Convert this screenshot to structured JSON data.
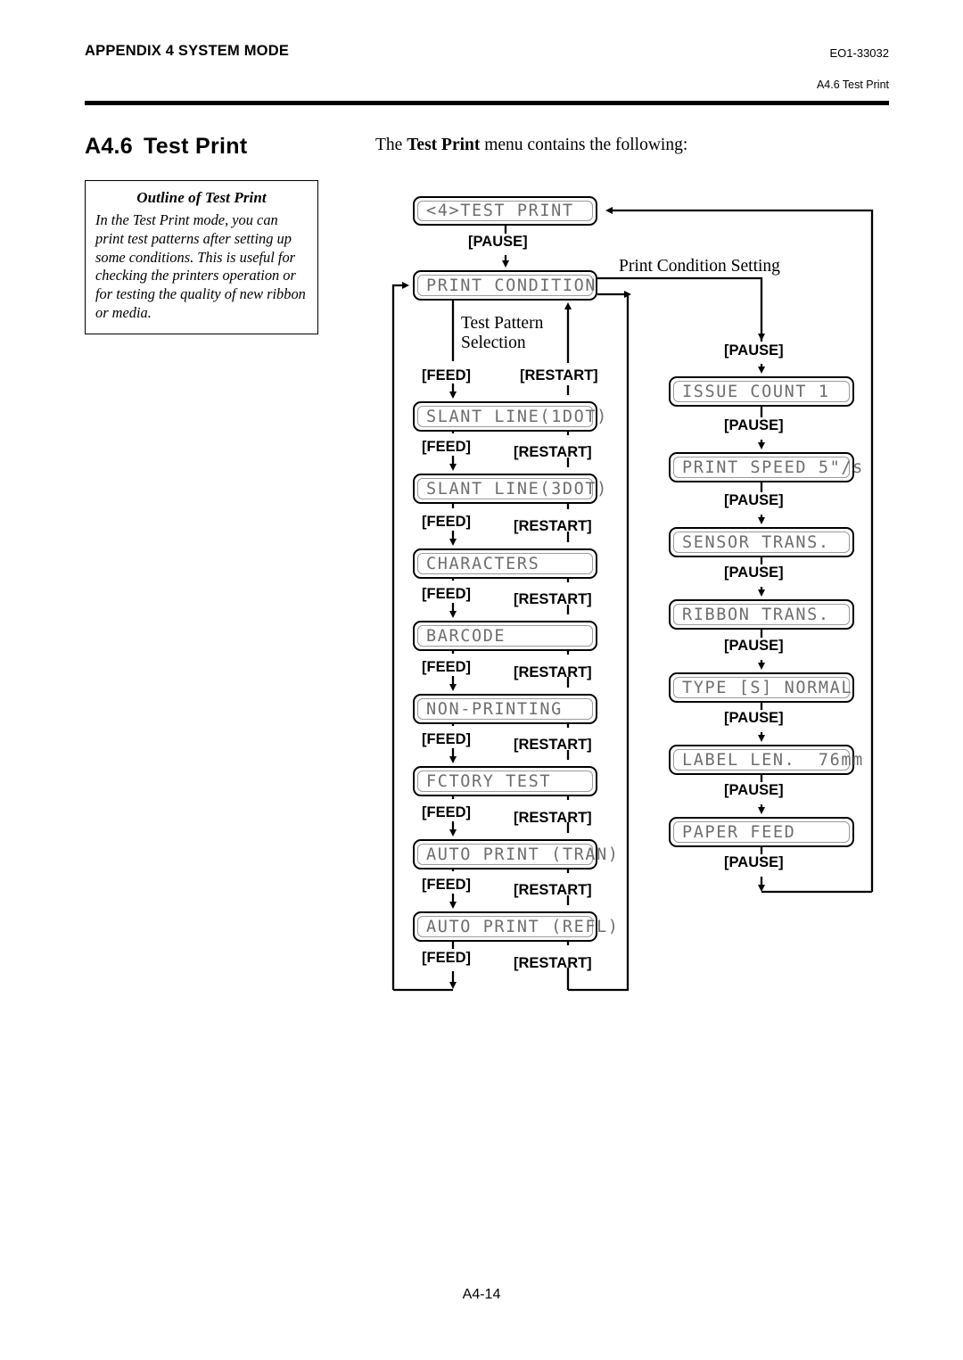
{
  "header": {
    "left_title": "APPENDIX 4 SYSTEM MODE",
    "doc_code": "EO1-33032",
    "section_ref": "A4.6 Test Print"
  },
  "section": {
    "number": "A4.6",
    "title": "Test Print"
  },
  "outline_box": {
    "title": "Outline of Test Print",
    "body": "In the Test Print mode, you can print test patterns after setting up some conditions. This is useful for checking the printers operation or for testing the quality of new ribbon or media."
  },
  "intro": {
    "before": "The ",
    "bold": "Test Print",
    "after": " menu contains the following:"
  },
  "annotations": {
    "print_condition_setting": "Print Condition Setting",
    "test_pattern_selection_line1": "Test Pattern",
    "test_pattern_selection_line2": "Selection"
  },
  "keys": {
    "pause": "[PAUSE]",
    "feed": "[FEED]",
    "restart": "[RESTART]"
  },
  "flow": {
    "root": {
      "label": "<4>TEST PRINT"
    },
    "print_condition": {
      "label": "PRINT CONDITION"
    },
    "test_pattern_boxes": [
      {
        "label": "SLANT LINE(1DOT)"
      },
      {
        "label": "SLANT LINE(3DOT)"
      },
      {
        "label": "CHARACTERS"
      },
      {
        "label": "BARCODE"
      },
      {
        "label": "NON-PRINTING"
      },
      {
        "label": "FCTORY TEST"
      },
      {
        "label": "AUTO PRINT (TRAN)"
      },
      {
        "label": "AUTO PRINT (REFL)"
      }
    ],
    "print_condition_boxes": [
      {
        "label": "ISSUE COUNT 1"
      },
      {
        "label": "PRINT SPEED 5\"/s"
      },
      {
        "label": "SENSOR TRANS."
      },
      {
        "label": "RIBBON TRANS."
      },
      {
        "label": "TYPE [S] NORMAL"
      },
      {
        "label": "LABEL LEN.  76mm"
      },
      {
        "label": "PAPER FEED"
      }
    ]
  },
  "footer": {
    "page": "A4-14"
  }
}
